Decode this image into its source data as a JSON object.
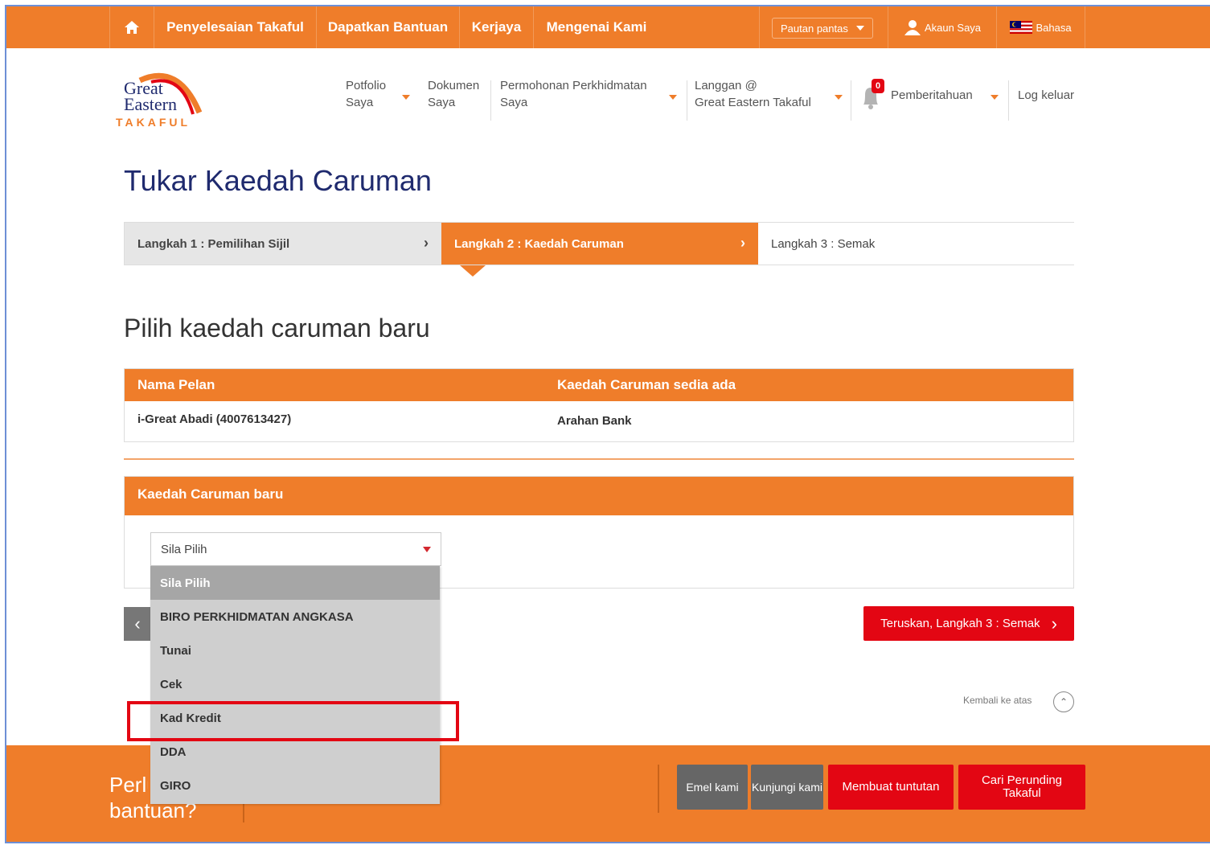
{
  "topbar": {
    "home_icon": "home-icon",
    "items": [
      "Penyelesaian Takaful",
      "Dapatkan Bantuan",
      "Kerjaya",
      "Mengenai Kami"
    ],
    "quick_links": "Pautan pantas",
    "account": "Akaun Saya",
    "language": "Bahasa"
  },
  "logo": {
    "line1": "Great",
    "line2": "Eastern",
    "line3": "TAKAFUL"
  },
  "nav": {
    "portfolio": [
      "Potfolio",
      "Saya"
    ],
    "documents": [
      "Dokumen",
      "Saya"
    ],
    "service": [
      "Permohonan Perkhidmatan",
      "Saya"
    ],
    "subscribe": [
      "Langgan @",
      "Great Eastern Takaful"
    ],
    "notif_count": "0",
    "notifications": "Pemberitahuan",
    "logout": "Log keluar"
  },
  "page_title": "Tukar Kaedah Caruman",
  "steps": [
    "Langkah 1 : Pemilihan Sijil",
    "Langkah 2 : Kaedah Caruman",
    "Langkah 3 : Semak"
  ],
  "subtitle": "Pilih kaedah caruman baru",
  "plan_table": {
    "headers": [
      "Nama Pelan",
      "Kaedah Caruman sedia ada"
    ],
    "row": [
      "i-Great Abadi (4007613427)",
      "Arahan Bank"
    ]
  },
  "new_method": {
    "header": "Kaedah Caruman baru",
    "selected": "Sila Pilih",
    "options": [
      "Sila Pilih",
      "BIRO PERKHIDMATAN ANGKASA",
      "Tunai",
      "Cek",
      "Kad Kredit",
      "DDA",
      "GIRO"
    ]
  },
  "buttons": {
    "back": "‹",
    "next": "Teruskan, Langkah 3 : Semak",
    "next_arrow": "›"
  },
  "back_to_top": "Kembali ke atas",
  "footer": {
    "help_line1": "Perlu",
    "help_line2": "bantuan?",
    "email": "Emel kami",
    "visit": "Kunjungi kami",
    "claim": "Membuat tuntutan",
    "find": [
      "Cari Perunding",
      "Takaful"
    ]
  },
  "colors": {
    "orange": "#ef7d2a",
    "red": "#e30613",
    "navy": "#1f2a6e"
  }
}
